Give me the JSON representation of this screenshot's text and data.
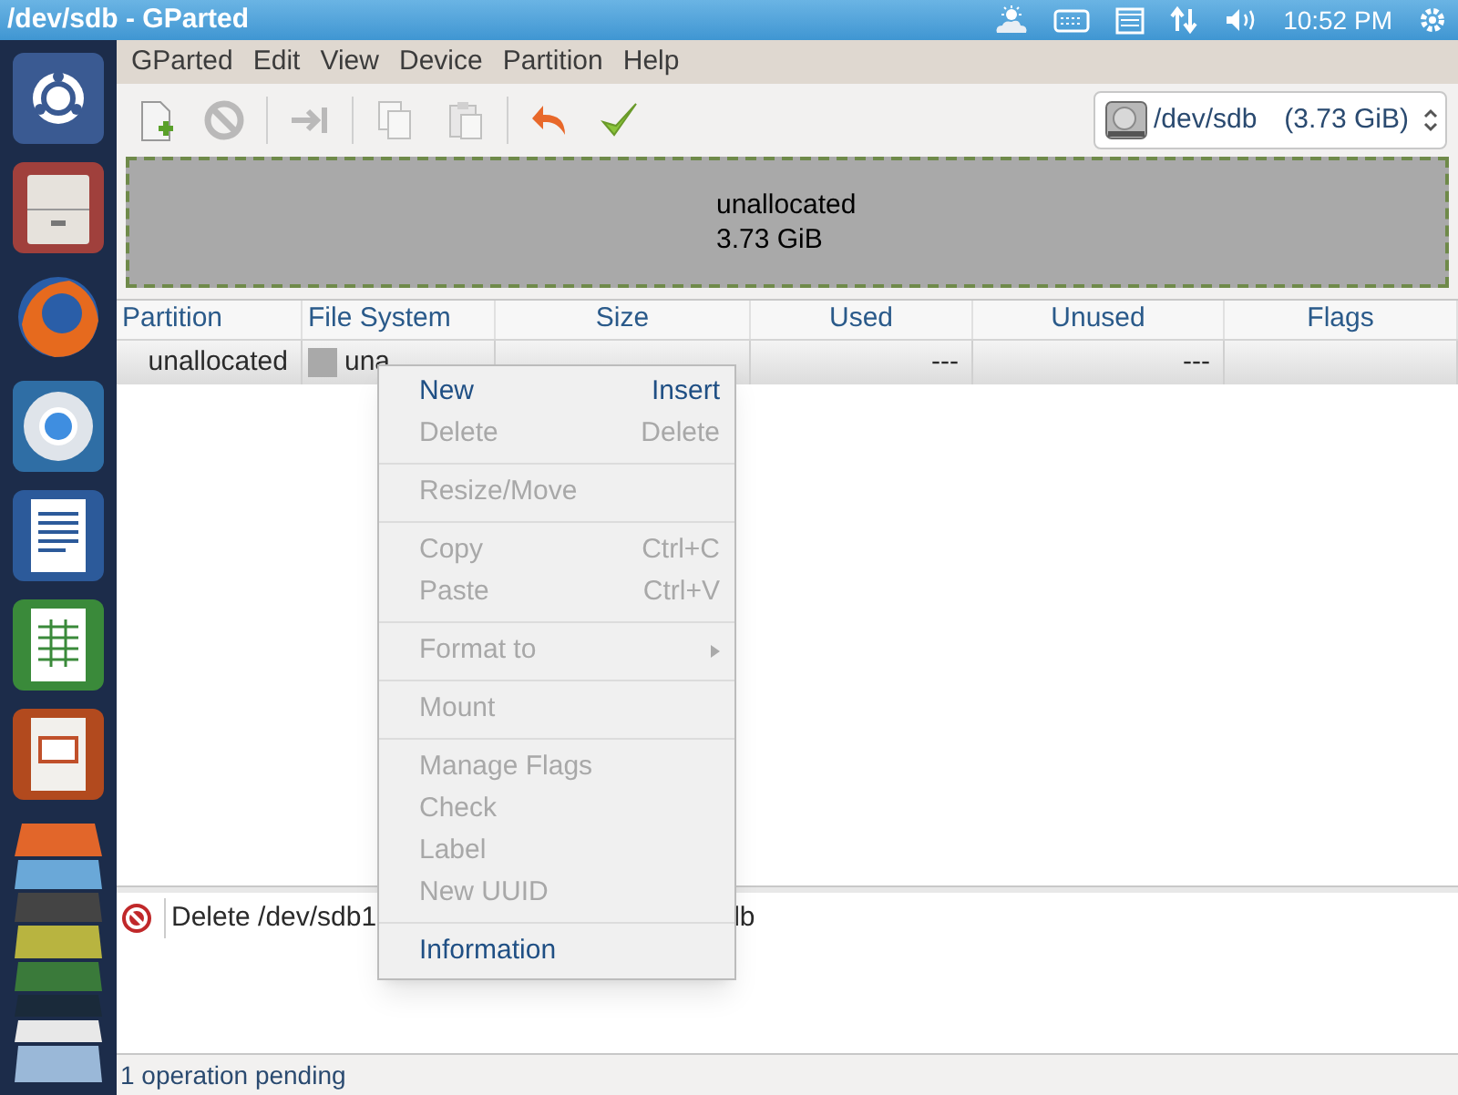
{
  "window": {
    "title": "/dev/sdb - GParted"
  },
  "top_panel": {
    "clock": "10:52 PM"
  },
  "launcher": {
    "items": [
      {
        "kind": "ubuntu"
      },
      {
        "kind": "files"
      },
      {
        "kind": "firefox"
      },
      {
        "kind": "chromium"
      },
      {
        "kind": "writer"
      },
      {
        "kind": "calc"
      },
      {
        "kind": "impress"
      }
    ]
  },
  "menu_bar": [
    "GParted",
    "Edit",
    "View",
    "Device",
    "Partition",
    "Help"
  ],
  "toolbar": [
    {
      "kind": "new",
      "disabled": false
    },
    {
      "kind": "delete",
      "disabled": true
    },
    {
      "kind": "sep"
    },
    {
      "kind": "resize",
      "disabled": true
    },
    {
      "kind": "sep"
    },
    {
      "kind": "copy",
      "disabled": true
    },
    {
      "kind": "paste",
      "disabled": true
    },
    {
      "kind": "sep"
    },
    {
      "kind": "undo",
      "disabled": false
    },
    {
      "kind": "apply",
      "disabled": false
    }
  ],
  "device_selector": {
    "device": "/dev/sdb",
    "size": "(3.73 GiB)"
  },
  "disk_map": {
    "label": "unallocated",
    "size": "3.73 GiB"
  },
  "table": {
    "columns": [
      "Partition",
      "File System",
      "Size",
      "Used",
      "Unused",
      "Flags"
    ],
    "rows": [
      {
        "selected": true,
        "partition": "unallocated",
        "file_system": "una",
        "used": "---",
        "unused": "---"
      }
    ]
  },
  "context_menu": [
    {
      "kind": "item",
      "label": "New",
      "shortcut": "Insert",
      "disabled": false
    },
    {
      "kind": "item",
      "label": "Delete",
      "shortcut": "Delete",
      "disabled": true
    },
    {
      "kind": "sep"
    },
    {
      "kind": "item",
      "label": "Resize/Move",
      "disabled": true
    },
    {
      "kind": "sep"
    },
    {
      "kind": "item",
      "label": "Copy",
      "shortcut": "Ctrl+C",
      "disabled": true
    },
    {
      "kind": "item",
      "label": "Paste",
      "shortcut": "Ctrl+V",
      "disabled": true
    },
    {
      "kind": "sep"
    },
    {
      "kind": "submenu",
      "label": "Format to",
      "disabled": true
    },
    {
      "kind": "sep"
    },
    {
      "kind": "item",
      "label": "Mount",
      "disabled": true
    },
    {
      "kind": "sep"
    },
    {
      "kind": "item",
      "label": "Manage Flags",
      "disabled": true
    },
    {
      "kind": "item",
      "label": "Check",
      "disabled": true
    },
    {
      "kind": "item",
      "label": "Label",
      "disabled": true
    },
    {
      "kind": "item",
      "label": "New UUID",
      "disabled": true
    },
    {
      "kind": "sep"
    },
    {
      "kind": "item",
      "label": "Information",
      "disabled": false
    }
  ],
  "operations": [
    {
      "text": "Delete /dev/sdb1",
      "tail": "lb"
    }
  ],
  "status_bar": "1 operation pending"
}
